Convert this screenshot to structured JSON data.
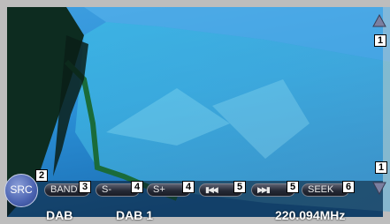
{
  "controls": {
    "src_label": "SRC",
    "band_label": "BAND",
    "seek_minus_label": "S-",
    "seek_plus_label": "S+",
    "prev_glyph": "▶◀◀",
    "next_glyph": "▶▶▶",
    "seek_label": "SEEK"
  },
  "callouts": {
    "scroll_up": "1",
    "scroll_down": "1",
    "src": "2",
    "band": "3",
    "s_minus": "4",
    "s_plus": "4",
    "prev": "5",
    "next": "5",
    "seek": "6"
  },
  "status": {
    "source": "DAB",
    "preset": "DAB 1",
    "frequency": "220.094MHz"
  },
  "icons": [
    "triangle-up-icon",
    "triangle-down-icon",
    "prev-track-icon",
    "next-track-icon"
  ],
  "colors": {
    "frame": "#bdbdbd",
    "sky": "#2a8fd6",
    "button": "#262a36",
    "src_button": "#4a62b0"
  }
}
